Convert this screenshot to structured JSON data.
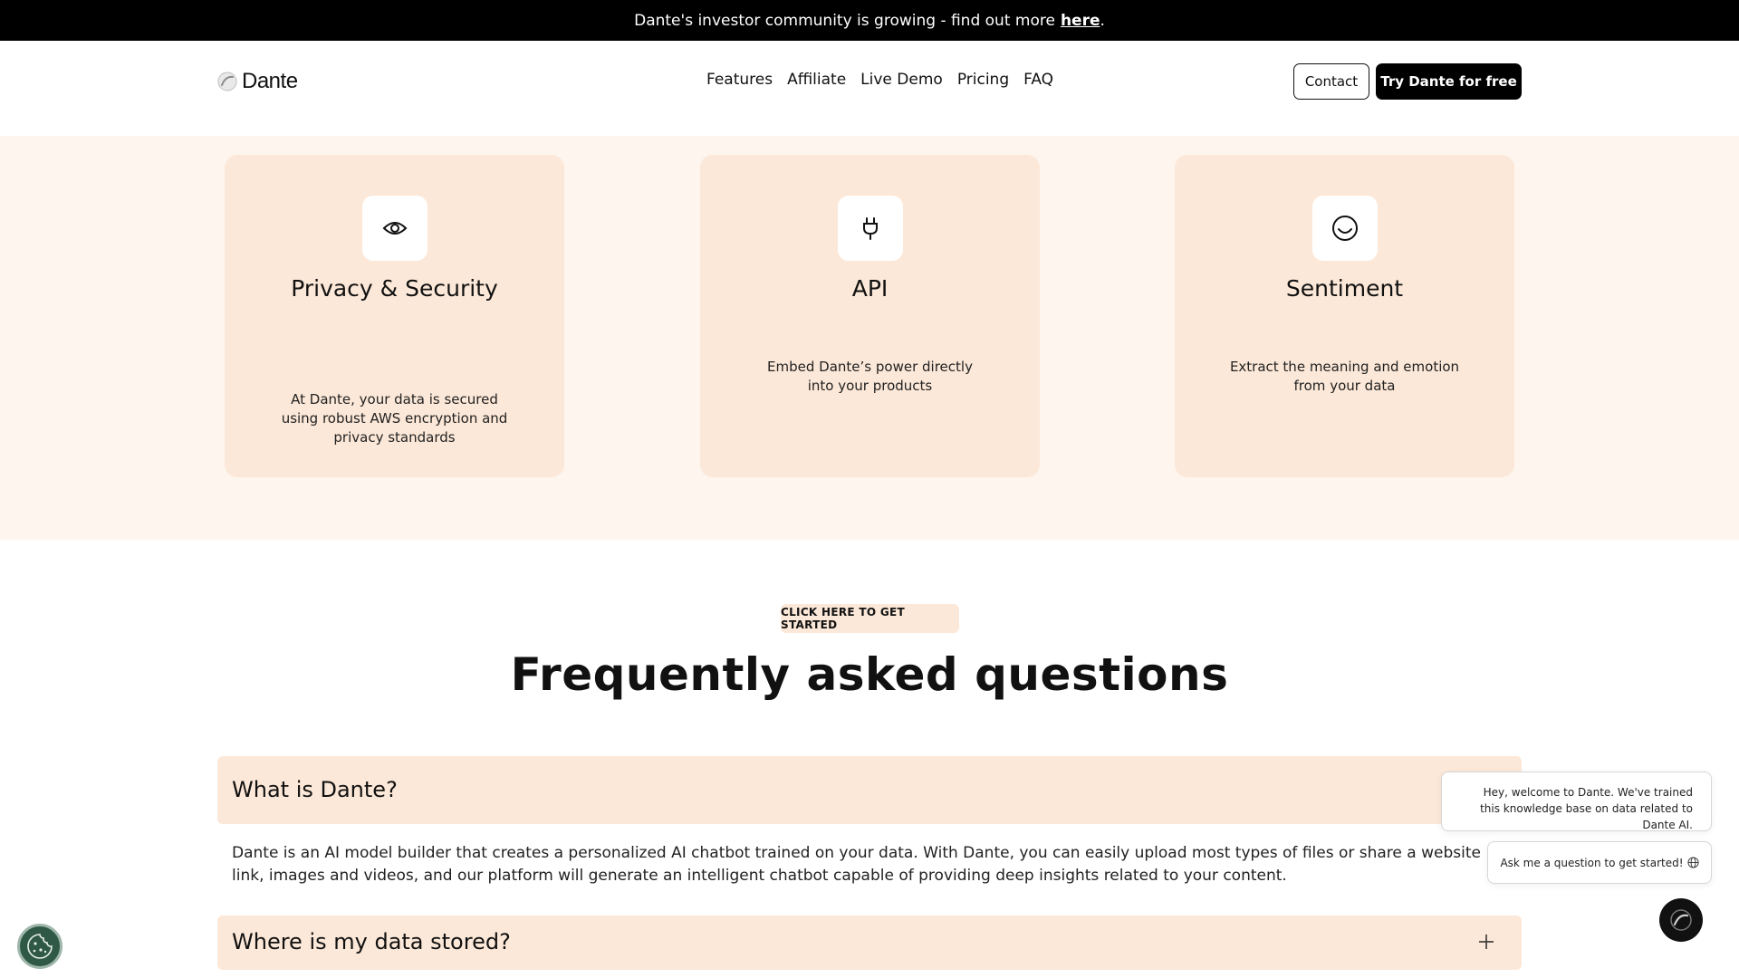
{
  "announcement": {
    "text": "Dante's investor community is growing - find out more",
    "link_label": "here",
    "period": "."
  },
  "header": {
    "logo_text": "Dante",
    "nav": [
      "Features",
      "Affiliate",
      "Live Demo",
      "Pricing",
      "FAQ"
    ],
    "contact_label": "Contact",
    "try_label": "Try Dante for free"
  },
  "features": {
    "cards": [
      {
        "icon": "eye-icon",
        "title": "Privacy & Security",
        "desc": "At Dante, your data is secured using robust AWS encryption and privacy standards"
      },
      {
        "icon": "plug-icon",
        "title": "API",
        "desc": "Embed Dante’s power directly into your products"
      },
      {
        "icon": "smile-icon",
        "title": "Sentiment",
        "desc": "Extract the meaning and emotion from your data"
      }
    ]
  },
  "faq": {
    "cta_label": "CLICK HERE TO GET STARTED",
    "title": "Frequently asked questions",
    "items": [
      {
        "question": "What is Dante?",
        "answer": "Dante is an AI model builder that creates a personalized AI chatbot trained on your data. With Dante, you can easily upload most types of files or share a website link, images and videos, and our platform will generate an intelligent chatbot capable of providing deep insights related to your content."
      },
      {
        "question": "Where is my data stored?"
      }
    ]
  },
  "chat": {
    "welcome": "Hey, welcome to Dante. We've trained this knowledge base on data related to Dante AI.",
    "prompt": "Ask me a question to get started!",
    "prompt_icon": "globe-icon",
    "launcher_icon": "dante-logo-icon"
  },
  "cookie": {
    "icon": "cookie-icon"
  },
  "colors": {
    "accent_bg": "#fce8d8",
    "section_bg": "#fdf5ee",
    "dark": "#000000",
    "cookie_green": "#2f5846"
  }
}
